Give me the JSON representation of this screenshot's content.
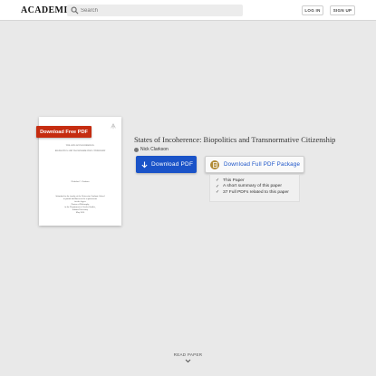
{
  "header": {
    "logo": "ACADEMIA",
    "search_placeholder": "Search",
    "login_label": "LOG IN",
    "signup_label": "SIGN UP"
  },
  "document_preview": {
    "download_free_label": "Download Free PDF",
    "lines": [
      "THE ARTS OF INCOHERENCE:",
      "BIOPOLITICS AND TRANSNORMATIVE CITIZENSHIP",
      "Nicholas C. Clarkson",
      "Submitted to the faculty of the University Graduate School",
      "in partial fulfillment of the requirements",
      "for the degree",
      "Doctor of Philosophy",
      "in the Department of Gender Studies,",
      "Indiana University",
      "May 2016"
    ]
  },
  "paper": {
    "title": "States of Incoherence: Biopolitics and Transnormative Citizenship",
    "author": "Nick Clarkson"
  },
  "actions": {
    "download_pdf_label": "Download PDF",
    "package_label": "Download Full PDF Package",
    "package_items": [
      "This Paper",
      "A short summary of this paper",
      "37 Full PDFs related to this paper"
    ]
  },
  "footer": {
    "read_paper_label": "READ PAPER"
  },
  "colors": {
    "primary_blue": "#1a53c8",
    "download_red": "#c52c10",
    "package_gold": "#b08a34",
    "background": "#e9e9e9"
  }
}
